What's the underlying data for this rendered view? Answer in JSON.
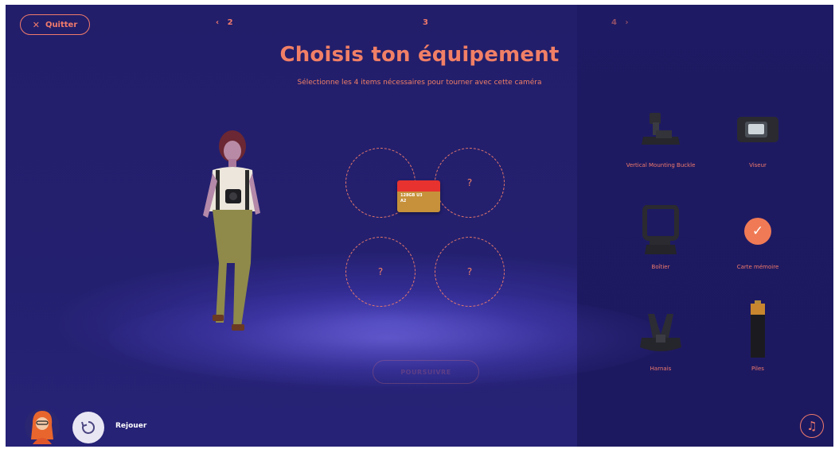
{
  "header": {
    "quit_label": "Quitter",
    "prev_step": "2",
    "current_step": "3",
    "next_step": "4"
  },
  "main": {
    "title": "Choisis ton équipement",
    "subtitle": "Sélectionne les 4 items nécessaires pour tourner avec cette caméra",
    "slots": [
      {
        "label": ""
      },
      {
        "label": "?"
      },
      {
        "label": "?"
      },
      {
        "label": "?"
      }
    ],
    "sd_card": {
      "capacity": "128GB",
      "class": "U3",
      "a": "A2"
    },
    "next_label": "POURSUIVRE"
  },
  "items": [
    {
      "label": "Vertical Mounting Buckle",
      "icon": "mounting-buckle-icon",
      "selected": false
    },
    {
      "label": "Viseur",
      "icon": "viewfinder-icon",
      "selected": false
    },
    {
      "label": "Boîtier",
      "icon": "camera-case-icon",
      "selected": false
    },
    {
      "label": "Carte mémoire",
      "icon": "check-icon",
      "selected": true
    },
    {
      "label": "Harnais",
      "icon": "chest-harness-icon",
      "selected": false
    },
    {
      "label": "Piles",
      "icon": "battery-icon",
      "selected": false
    }
  ],
  "footer": {
    "replay_label": "Rejouer"
  },
  "colors": {
    "accent": "#f07a6b",
    "background": "#221e6a",
    "panel": "#1e1a63"
  }
}
